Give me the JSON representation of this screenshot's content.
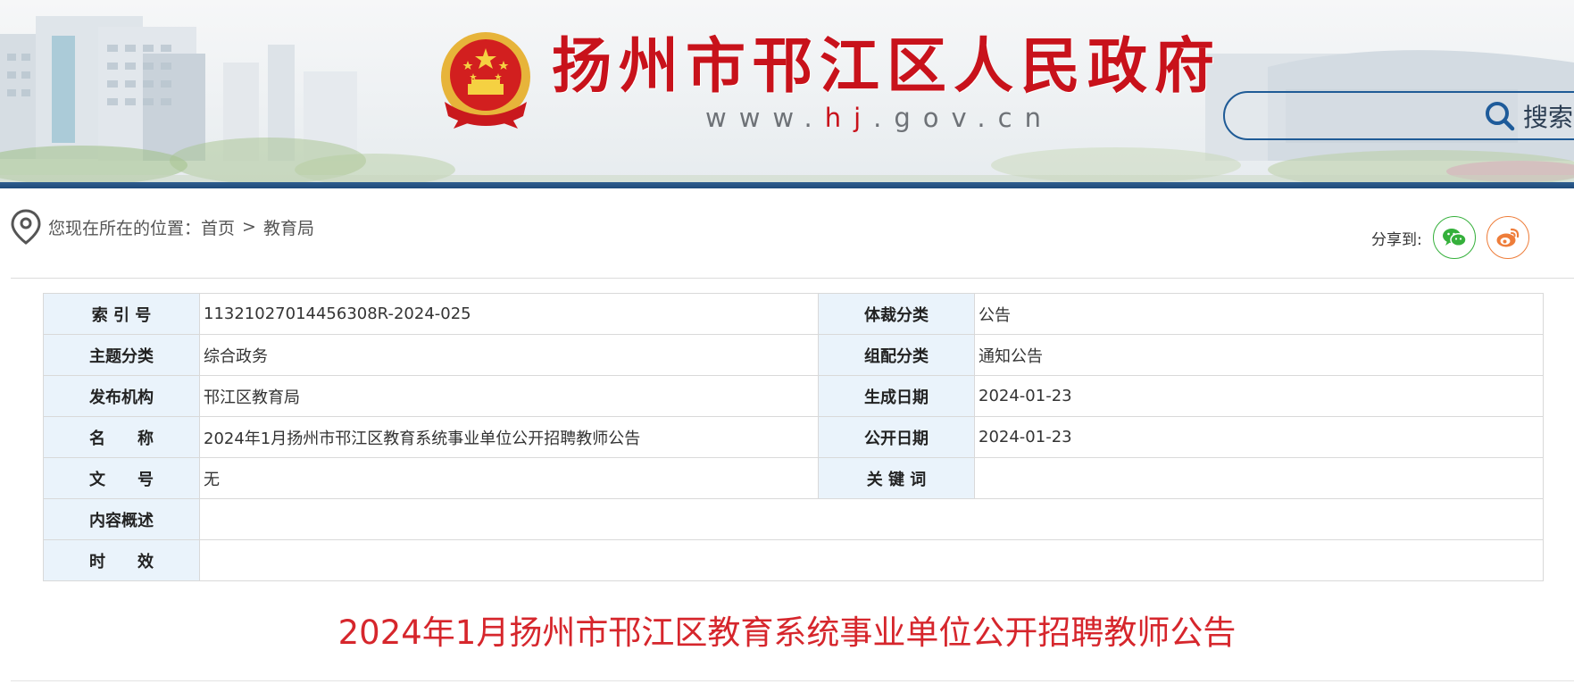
{
  "header": {
    "site_title": "扬州市邗江区人民政府",
    "url_prefix": "www.",
    "url_highlight": "hj",
    "url_suffix": ".gov.cn",
    "emblem_icon": "national-emblem-icon",
    "search": {
      "placeholder": "",
      "button_label": "搜索",
      "icon": "search-icon"
    }
  },
  "breadcrumb": {
    "prefix": "您现在所在的位置：",
    "home": "首页",
    "separator": ">",
    "current": "教育局",
    "icon": "location-pin-icon"
  },
  "share": {
    "label": "分享到:",
    "wechat_icon": "wechat-icon",
    "weibo_icon": "weibo-icon"
  },
  "info": {
    "index_no": {
      "label": "索 引 号",
      "value": "11321027014456308R-2024-025"
    },
    "genre": {
      "label": "体裁分类",
      "value": "公告"
    },
    "topic": {
      "label": "主题分类",
      "value": "综合政务"
    },
    "group": {
      "label": "组配分类",
      "value": "通知公告"
    },
    "publisher": {
      "label": "发布机构",
      "value": "邗江区教育局"
    },
    "created": {
      "label": "生成日期",
      "value": "2024-01-23"
    },
    "name": {
      "label": "名　　称",
      "value": "2024年1月扬州市邗江区教育系统事业单位公开招聘教师公告"
    },
    "published": {
      "label": "公开日期",
      "value": "2024-01-23"
    },
    "doc_no": {
      "label": "文　　号",
      "value": "无"
    },
    "keywords": {
      "label": "关 键 词",
      "value": ""
    },
    "summary": {
      "label": "内容概述",
      "value": ""
    },
    "validity": {
      "label": "时　　效",
      "value": ""
    }
  },
  "article": {
    "title": "2024年1月扬州市邗江区教育系统事业单位公开招聘教师公告"
  },
  "colors": {
    "brand_red": "#c8121b",
    "title_red": "#d6262c",
    "nav_blue": "#1e4a7a",
    "label_bg": "#eaf3fb"
  }
}
